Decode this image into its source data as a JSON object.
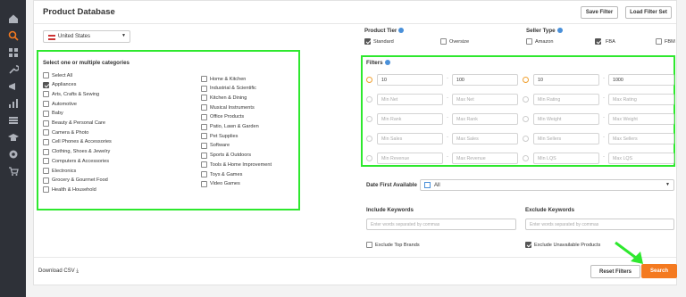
{
  "rail_icons": [
    "home-icon",
    "search-icon",
    "grid-icon",
    "wrench-icon",
    "megaphone-icon",
    "chart-icon",
    "list-icon",
    "graduation-icon",
    "gear-icon",
    "cart-icon"
  ],
  "header": {
    "title": "Product Database",
    "save_filter": "Save Filter",
    "load_filter_set": "Load Filter Set"
  },
  "marketplace": {
    "value": "United States"
  },
  "categories": {
    "title": "Select one or multiple categories",
    "col1": [
      {
        "label": "Select All",
        "checked": false
      },
      {
        "label": "Appliances",
        "checked": true
      },
      {
        "label": "Arts, Crafts & Sewing",
        "checked": false
      },
      {
        "label": "Automotive",
        "checked": false
      },
      {
        "label": "Baby",
        "checked": false
      },
      {
        "label": "Beauty & Personal Care",
        "checked": false
      },
      {
        "label": "Camera & Photo",
        "checked": false
      },
      {
        "label": "Cell Phones & Accessories",
        "checked": false
      },
      {
        "label": "Clothing, Shoes & Jewelry",
        "checked": false
      },
      {
        "label": "Computers & Accessories",
        "checked": false
      },
      {
        "label": "Electronics",
        "checked": false
      },
      {
        "label": "Grocery & Gourmet Food",
        "checked": false
      },
      {
        "label": "Health & Household",
        "checked": false
      }
    ],
    "col2": [
      {
        "label": "Home & Kitchen",
        "checked": false
      },
      {
        "label": "Industrial & Scientific",
        "checked": false
      },
      {
        "label": "Kitchen & Dining",
        "checked": false
      },
      {
        "label": "Musical Instruments",
        "checked": false
      },
      {
        "label": "Office Products",
        "checked": false
      },
      {
        "label": "Patio, Lawn & Garden",
        "checked": false
      },
      {
        "label": "Pet Supplies",
        "checked": false
      },
      {
        "label": "Software",
        "checked": false
      },
      {
        "label": "Sports & Outdoors",
        "checked": false
      },
      {
        "label": "Tools & Home Improvement",
        "checked": false
      },
      {
        "label": "Toys & Games",
        "checked": false
      },
      {
        "label": "Video Games",
        "checked": false
      }
    ]
  },
  "product_tier": {
    "label": "Product Tier",
    "standard": "Standard",
    "oversize": "Oversize",
    "standard_checked": true,
    "oversize_checked": false
  },
  "seller_type": {
    "label": "Seller Type",
    "amazon": "Amazon",
    "fba": "FBA",
    "fbm": "FBM",
    "amazon_checked": false,
    "fba_checked": true,
    "fbm_checked": false
  },
  "filters": {
    "label": "Filters",
    "left": [
      {
        "min": "10",
        "max": "100",
        "min_ph": "",
        "max_ph": ""
      },
      {
        "min": "",
        "max": "",
        "min_ph": "Min Net",
        "max_ph": "Max Net"
      },
      {
        "min": "",
        "max": "",
        "min_ph": "Min Rank",
        "max_ph": "Max Rank"
      },
      {
        "min": "",
        "max": "",
        "min_ph": "Min Sales",
        "max_ph": "Max Sales"
      },
      {
        "min": "",
        "max": "",
        "min_ph": "Min Revenue",
        "max_ph": "Max Revenue"
      }
    ],
    "right": [
      {
        "min": "10",
        "max": "1000",
        "min_ph": "",
        "max_ph": ""
      },
      {
        "min": "",
        "max": "",
        "min_ph": "Min Rating",
        "max_ph": "Max Rating"
      },
      {
        "min": "",
        "max": "",
        "min_ph": "Min Weight",
        "max_ph": "Max Weight"
      },
      {
        "min": "",
        "max": "",
        "min_ph": "Min Sellers",
        "max_ph": "Max Sellers"
      },
      {
        "min": "",
        "max": "",
        "min_ph": "Min LQS",
        "max_ph": "Max LQS"
      }
    ]
  },
  "date_first": {
    "label": "Date First Available",
    "value": "All"
  },
  "include_kw": {
    "label": "Include Keywords",
    "placeholder": "Enter words separated by commas"
  },
  "exclude_kw": {
    "label": "Exclude Keywords",
    "placeholder": "Enter words separated by commas"
  },
  "exclude_top_brands": {
    "label": "Exclude Top Brands",
    "checked": false
  },
  "exclude_unavailable": {
    "label": "Exclude Unavailable Products",
    "checked": true
  },
  "footer": {
    "download_csv": "Download CSV",
    "reset_filters": "Reset Filters",
    "search": "Search"
  },
  "colors": {
    "highlight": "#2ee82e",
    "search": "#f47a20",
    "rail": "#2e3138"
  }
}
